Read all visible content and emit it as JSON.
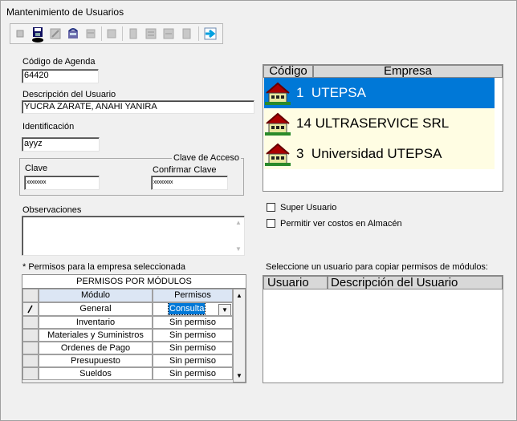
{
  "window": {
    "title": "Mantenimiento de Usuarios"
  },
  "toolbar": {
    "buttons": [
      "first-icon",
      "save-icon",
      "edit-icon",
      "undo-icon",
      "delete-icon",
      "print-icon",
      "prev-icon",
      "next-icon",
      "last-icon",
      "exit-icon"
    ]
  },
  "form": {
    "codigo_agenda": {
      "label": "Código de Agenda",
      "value": "64420"
    },
    "descripcion": {
      "label": "Descripción del Usuario",
      "value": "YUCRA ZARATE, ANAHI YANIRA"
    },
    "identificacion": {
      "label": "Identificación",
      "value": "ayyz"
    },
    "clave_group": {
      "legend": "Clave de Acceso"
    },
    "clave": {
      "label": "Clave",
      "value": "xxxxxxxx"
    },
    "confirmar": {
      "label": "Confirmar Clave",
      "value": "xxxxxxxx"
    },
    "observaciones": {
      "label": "Observaciones",
      "value": ""
    }
  },
  "empresas": {
    "headers": {
      "codigo": "Código",
      "empresa": "Empresa"
    },
    "rows": [
      {
        "codigo": "1",
        "empresa": "UTEPSA",
        "selected": true
      },
      {
        "codigo": "14",
        "empresa": "ULTRASERVICE SRL",
        "selected": false
      },
      {
        "codigo": "3",
        "empresa": "Universidad UTEPSA",
        "selected": false
      }
    ]
  },
  "options": {
    "super_usuario": {
      "label": "Super Usuario",
      "checked": false
    },
    "ver_costos": {
      "label": "Permitir ver costos en Almacén",
      "checked": false
    }
  },
  "permisos": {
    "note": "* Permisos para la empresa seleccionada",
    "title": "PERMISOS POR MÓDULOS",
    "headers": {
      "modulo": "Módulo",
      "permisos": "Permisos"
    },
    "rows": [
      {
        "modulo": "General",
        "permiso": "Consulta"
      },
      {
        "modulo": "Inventario",
        "permiso": "Sin permiso"
      },
      {
        "modulo": "Materiales y Suministros",
        "permiso": "Sin permiso"
      },
      {
        "modulo": "Ordenes de Pago",
        "permiso": "Sin permiso"
      },
      {
        "modulo": "Presupuesto",
        "permiso": "Sin permiso"
      },
      {
        "modulo": "Sueldos",
        "permiso": "Sin permiso"
      }
    ]
  },
  "copiar": {
    "label": "Seleccione un usuario para copiar permisos de módulos:",
    "headers": {
      "usuario": "Usuario",
      "descripcion": "Descripción del Usuario"
    }
  },
  "colors": {
    "selection": "#0078d7",
    "row_alt": "#fffde3",
    "header": "#d8d8d8"
  }
}
